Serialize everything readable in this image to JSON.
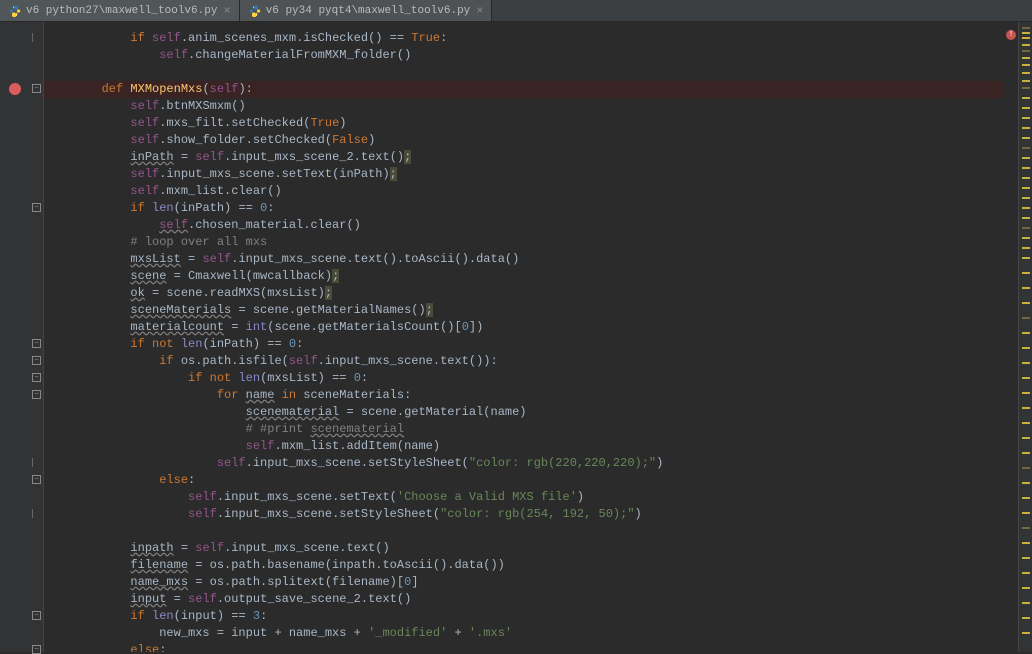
{
  "tabs": [
    {
      "label": "v6 python27\\maxwell_toolv6.py",
      "active": false
    },
    {
      "label": "v6 py34 pyqt4\\maxwell_toolv6.py",
      "active": true
    }
  ],
  "close_glyph": "×",
  "fold_minus": "−",
  "code_lines": [
    {
      "indent": 8,
      "tokens": [
        [
          "kw",
          "if"
        ],
        [
          "",
          " "
        ],
        [
          "self",
          "self"
        ],
        [
          "",
          ".anim_scenes_mxm.isChecked() == "
        ],
        [
          "const",
          "True"
        ],
        [
          "",
          ":"
        ]
      ]
    },
    {
      "indent": 12,
      "tokens": [
        [
          "self",
          "self"
        ],
        [
          "",
          ".changeMaterialFromMXM_folder()"
        ]
      ]
    },
    {
      "indent": 0,
      "tokens": [
        [
          "",
          ""
        ]
      ]
    },
    {
      "indent": 4,
      "breakpoint": true,
      "tokens": [
        [
          "kw",
          "def"
        ],
        [
          "",
          " "
        ],
        [
          "func",
          "MXMopenMxs"
        ],
        [
          "",
          "("
        ],
        [
          "self",
          "self"
        ],
        [
          "",
          "):"
        ]
      ]
    },
    {
      "indent": 8,
      "tokens": [
        [
          "self",
          "self"
        ],
        [
          "",
          ".btnMXSmxm()"
        ]
      ]
    },
    {
      "indent": 8,
      "tokens": [
        [
          "self",
          "self"
        ],
        [
          "",
          ".mxs_filt.setChecked("
        ],
        [
          "const",
          "True"
        ],
        [
          "",
          ")"
        ]
      ]
    },
    {
      "indent": 8,
      "tokens": [
        [
          "self",
          "self"
        ],
        [
          "",
          ".show_folder.setChecked("
        ],
        [
          "const",
          "False"
        ],
        [
          "",
          ")"
        ]
      ]
    },
    {
      "indent": 8,
      "tokens": [
        [
          "warn",
          "inPath"
        ],
        [
          "",
          " = "
        ],
        [
          "self",
          "self"
        ],
        [
          "",
          ".input_mxs_scene_2.text()"
        ],
        [
          "caret-bg",
          ";"
        ]
      ]
    },
    {
      "indent": 8,
      "tokens": [
        [
          "self",
          "self"
        ],
        [
          "",
          ".input_mxs_scene.setText(inPath)"
        ],
        [
          "caret-bg",
          ";"
        ]
      ]
    },
    {
      "indent": 8,
      "tokens": [
        [
          "self",
          "self"
        ],
        [
          "",
          ".mxm_list.clear()"
        ]
      ]
    },
    {
      "indent": 8,
      "tokens": [
        [
          "kw",
          "if"
        ],
        [
          "",
          " "
        ],
        [
          "builtin",
          "len"
        ],
        [
          "",
          "(inPath) == "
        ],
        [
          "num",
          "0"
        ],
        [
          "",
          ":"
        ]
      ]
    },
    {
      "indent": 12,
      "tokens": [
        [
          "self warn",
          "self"
        ],
        [
          "",
          ".chosen_material.clear()"
        ]
      ]
    },
    {
      "indent": 8,
      "tokens": [
        [
          "comment",
          "# loop over all mxs"
        ]
      ]
    },
    {
      "indent": 8,
      "tokens": [
        [
          "warn",
          "mxsList"
        ],
        [
          "",
          " = "
        ],
        [
          "self",
          "self"
        ],
        [
          "",
          ".input_mxs_scene.text().toAscii().data()"
        ]
      ]
    },
    {
      "indent": 8,
      "tokens": [
        [
          "warn",
          "scene"
        ],
        [
          "",
          " = Cmaxwell(mwcallback)"
        ],
        [
          "caret-bg",
          ";"
        ]
      ]
    },
    {
      "indent": 8,
      "tokens": [
        [
          "warn",
          "ok"
        ],
        [
          "",
          " = scene.readMXS(mxsList)"
        ],
        [
          "caret-bg",
          ";"
        ]
      ]
    },
    {
      "indent": 8,
      "tokens": [
        [
          "warn",
          "sceneMaterials"
        ],
        [
          "",
          " = scene.getMaterialNames()"
        ],
        [
          "caret-bg",
          ";"
        ]
      ]
    },
    {
      "indent": 8,
      "tokens": [
        [
          "warn",
          "materialcount"
        ],
        [
          "",
          " = "
        ],
        [
          "builtin",
          "int"
        ],
        [
          "",
          "(scene.getMaterialsCount()["
        ],
        [
          "num",
          "0"
        ],
        [
          "",
          "])"
        ]
      ]
    },
    {
      "indent": 8,
      "tokens": [
        [
          "kw",
          "if"
        ],
        [
          "",
          " "
        ],
        [
          "kw",
          "not"
        ],
        [
          "",
          " "
        ],
        [
          "builtin",
          "len"
        ],
        [
          "",
          "(inPath) == "
        ],
        [
          "num",
          "0"
        ],
        [
          "",
          ":"
        ]
      ]
    },
    {
      "indent": 12,
      "tokens": [
        [
          "kw",
          "if"
        ],
        [
          "",
          " os.path.isfile("
        ],
        [
          "self",
          "self"
        ],
        [
          "",
          ".input_mxs_scene.text()):"
        ]
      ]
    },
    {
      "indent": 16,
      "tokens": [
        [
          "kw",
          "if"
        ],
        [
          "",
          " "
        ],
        [
          "kw",
          "not"
        ],
        [
          "",
          " "
        ],
        [
          "builtin",
          "len"
        ],
        [
          "",
          "(mxsList) == "
        ],
        [
          "num",
          "0"
        ],
        [
          "",
          ":"
        ]
      ]
    },
    {
      "indent": 20,
      "tokens": [
        [
          "kw",
          "for"
        ],
        [
          "",
          " "
        ],
        [
          "warn",
          "name"
        ],
        [
          "",
          " "
        ],
        [
          "kw",
          "in"
        ],
        [
          "",
          " sceneMaterials:"
        ]
      ]
    },
    {
      "indent": 24,
      "tokens": [
        [
          "warn",
          "scenematerial"
        ],
        [
          "",
          " = scene.getMaterial(name)"
        ]
      ]
    },
    {
      "indent": 24,
      "tokens": [
        [
          "comment",
          "# #print "
        ],
        [
          "comment warn",
          "scenematerial"
        ]
      ]
    },
    {
      "indent": 24,
      "tokens": [
        [
          "self",
          "self"
        ],
        [
          "",
          ".mxm_list.addItem(name)"
        ]
      ]
    },
    {
      "indent": 20,
      "tokens": [
        [
          "self",
          "self"
        ],
        [
          "",
          ".input_mxs_scene.setStyleSheet("
        ],
        [
          "str",
          "\"color: rgb(220,220,220);\""
        ],
        [
          "",
          ")"
        ]
      ]
    },
    {
      "indent": 12,
      "tokens": [
        [
          "kw",
          "else"
        ],
        [
          "",
          ":"
        ]
      ]
    },
    {
      "indent": 16,
      "tokens": [
        [
          "self",
          "self"
        ],
        [
          "",
          ".input_mxs_scene.setText("
        ],
        [
          "str",
          "'Choose a Valid MXS file'"
        ],
        [
          "",
          ")"
        ]
      ]
    },
    {
      "indent": 16,
      "tokens": [
        [
          "self",
          "self"
        ],
        [
          "",
          ".input_mxs_scene.setStyleSheet("
        ],
        [
          "str",
          "\"color: rgb(254, 192, 50);\""
        ],
        [
          "",
          ")"
        ]
      ]
    },
    {
      "indent": 0,
      "tokens": [
        [
          "",
          ""
        ]
      ]
    },
    {
      "indent": 8,
      "tokens": [
        [
          "warn",
          "inpath"
        ],
        [
          "",
          " = "
        ],
        [
          "self",
          "self"
        ],
        [
          "",
          ".input_mxs_scene.text()"
        ]
      ]
    },
    {
      "indent": 8,
      "tokens": [
        [
          "warn",
          "filename"
        ],
        [
          "",
          " = os.path.basename(inpath.toAscii().data())"
        ]
      ]
    },
    {
      "indent": 8,
      "tokens": [
        [
          "warn",
          "name_mxs"
        ],
        [
          "",
          " = os.path.splitext(filename)["
        ],
        [
          "num",
          "0"
        ],
        [
          "",
          "]"
        ]
      ]
    },
    {
      "indent": 8,
      "tokens": [
        [
          "warn",
          "input"
        ],
        [
          "",
          " = "
        ],
        [
          "self",
          "self"
        ],
        [
          "",
          ".output_save_scene_2.text()"
        ]
      ]
    },
    {
      "indent": 8,
      "tokens": [
        [
          "kw",
          "if"
        ],
        [
          "",
          " "
        ],
        [
          "builtin",
          "len"
        ],
        [
          "",
          "(input) == "
        ],
        [
          "num",
          "3"
        ],
        [
          "",
          ":"
        ]
      ]
    },
    {
      "indent": 12,
      "tokens": [
        [
          "",
          "new_mxs = input + name_mxs + "
        ],
        [
          "str",
          "'_modified'"
        ],
        [
          "",
          " + "
        ],
        [
          "str",
          "'.mxs'"
        ]
      ]
    },
    {
      "indent": 8,
      "tokens": [
        [
          "kw",
          "else"
        ],
        [
          "",
          ":"
        ]
      ]
    }
  ],
  "folds": [
    {
      "row": 0,
      "type": "bar"
    },
    {
      "row": 3,
      "type": "minus"
    },
    {
      "row": 10,
      "type": "minus"
    },
    {
      "row": 18,
      "type": "minus"
    },
    {
      "row": 19,
      "type": "minus"
    },
    {
      "row": 20,
      "type": "minus"
    },
    {
      "row": 21,
      "type": "minus"
    },
    {
      "row": 25,
      "type": "bar"
    },
    {
      "row": 26,
      "type": "minus"
    },
    {
      "row": 28,
      "type": "bar"
    },
    {
      "row": 34,
      "type": "minus"
    },
    {
      "row": 36,
      "type": "minus"
    }
  ]
}
